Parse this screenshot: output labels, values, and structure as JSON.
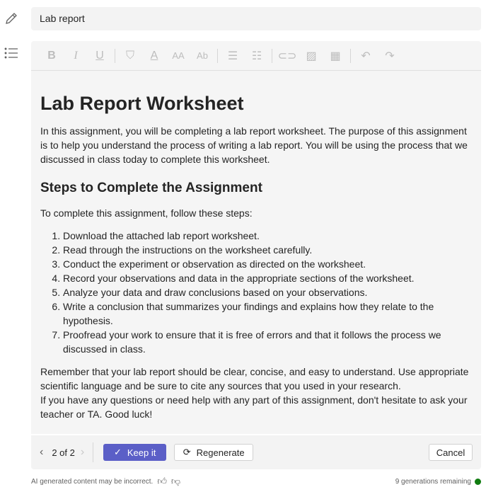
{
  "title_field": {
    "value": "Lab report"
  },
  "toolbar": {
    "icons": [
      "bold-icon",
      "italic-icon",
      "underline-icon",
      "highlight-icon",
      "font-color-icon",
      "font-size-icon",
      "clear-format-icon",
      "bullet-list-icon",
      "numbered-list-icon",
      "link-icon",
      "image-icon",
      "table-icon",
      "undo-icon",
      "redo-icon"
    ]
  },
  "content": {
    "h1": "Lab Report Worksheet",
    "intro": "In this assignment, you will be completing a lab report worksheet. The purpose of this assignment is to help you understand the process of writing a lab report. You will be using the process that we discussed in class today to complete this worksheet.",
    "h2": "Steps to Complete the Assignment",
    "lead": "To complete this assignment, follow these steps:",
    "steps": [
      "Download the attached lab report worksheet.",
      "Read through the instructions on the worksheet carefully.",
      "Conduct the experiment or observation as directed on the worksheet.",
      "Record your observations and data in the appropriate sections of the worksheet.",
      "Analyze your data and draw conclusions based on your observations.",
      "Write a conclusion that summarizes your findings and explains how they relate to the hypothesis.",
      "Proofread your work to ensure that it is free of errors and that it follows the process we discussed in class."
    ],
    "closing1": "Remember that your lab report should be clear, concise, and easy to understand. Use appropriate scientific language and be sure to cite any sources that you used in your research.",
    "closing2": "If you have any questions or need help with any part of this assignment, don't hesitate to ask your teacher or TA. Good luck!"
  },
  "footer": {
    "pager": "2 of 2",
    "keep": "Keep it",
    "regenerate": "Regenerate",
    "cancel": "Cancel"
  },
  "bottom": {
    "disclaimer": "AI generated content may be incorrect.",
    "remaining": "9 generations remaining",
    "status_color": "#107c10"
  },
  "colors": {
    "accent": "#5b5fc7"
  }
}
